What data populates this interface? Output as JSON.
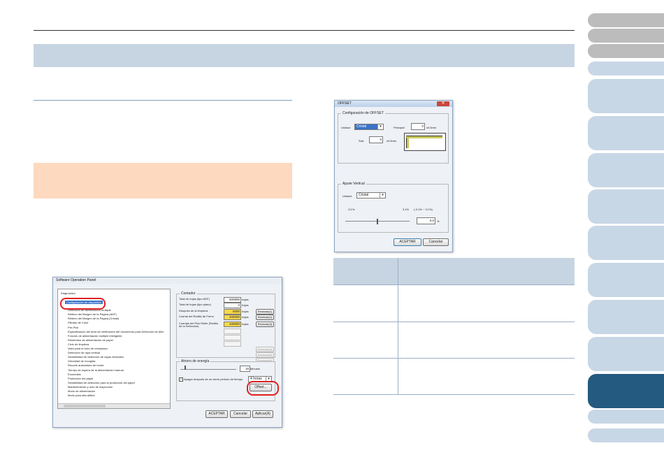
{
  "colors": {
    "header_bar": "#c7d5e2",
    "note_box": "#fcd9bf",
    "nav_active": "#245a80",
    "highlight": "#e02020",
    "counter_yellow": "#f5d84a"
  },
  "nav_tabs": [
    {
      "state": "gray"
    },
    {
      "state": "gray"
    },
    {
      "state": "gray"
    },
    {
      "state": "light"
    },
    {
      "state": "light"
    },
    {
      "state": "light"
    },
    {
      "state": "light"
    },
    {
      "state": "light"
    },
    {
      "state": "light"
    },
    {
      "state": "light"
    },
    {
      "state": "light"
    },
    {
      "state": "light"
    },
    {
      "state": "active"
    },
    {
      "state": "light"
    },
    {
      "state": "light"
    }
  ],
  "sop": {
    "title": "Software Operation Panel",
    "tree_root": "Diagnóstico",
    "tree_selected": "Configuración de dispositivo",
    "tree_items": [
      "Configuración del dispositivo",
      "Detección de alimentación múltiple",
      "Relleno del Margen de la Página (ADF)",
      "Relleno del Margen de la Página (Cristal)",
      "Filtrado de Color",
      "Pre-Pick",
      "Especificación del área de verificación del documento para Detección de Alim",
      "Función de alimentación múltiple inteligente",
      "Reintentos de alimentación de papel",
      "Ciclo de limpieza",
      "Valor para el ciclo de reemplazo",
      "Detección de raya vertical",
      "Sensibilidad de detección de rayas verticales",
      "Velocidad de recogida",
      "Recorte automático de borde",
      "Tiempo de espera de la alimentación manual",
      "Encendido",
      "Protección del papel",
      "Sensibilidad de detección para la protección del papel",
      "Mantenimiento y ciclo de inspección",
      "Modo de alimentación",
      "Modo para alta altitud"
    ],
    "counters_label": "Contador",
    "counters": [
      {
        "label": "Total de hojas (tipo ADF)",
        "value": "500895",
        "unit": "hojas",
        "button": ""
      },
      {
        "label": "Total de hojas (tipo plano)",
        "value": "0",
        "unit": "hojas",
        "button": ""
      },
      {
        "label": "Después de la limpieza",
        "value": "5000",
        "unit": "hojas",
        "button": "Reiniciar(1)"
      },
      {
        "label": "Cuenta del Rodillo de Freno",
        "value": "200000",
        "unit": "hojas",
        "button": "Reiniciar(2)"
      },
      {
        "label": "Cuentas del Pick Roller (Rodillo de la Selección)",
        "value": "100000",
        "unit": "hojas",
        "button": "Reiniciar(3)"
      }
    ],
    "disabled_buttons": [
      "Reiniciar(4)",
      "Reiniciar(5)",
      "Reiniciar(6)"
    ],
    "energy_label": "Ahorro de energía",
    "energy_value": "15",
    "energy_unit": "Minutos",
    "power_off_label": "Apagar después de un cierto periodo de tiempo",
    "power_off_value": "4 horas",
    "offset_button": "Offset...",
    "ok": "ACEPTAR",
    "cancel": "Cancelar",
    "apply": "Aplicar(A)"
  },
  "offset": {
    "title": "OFFSET",
    "close": "✕",
    "config_label": "Configuración de OFFSET",
    "unit_label": "Unidad:",
    "unit_value": "Cristal",
    "principal_label": "Principal:",
    "principal_value": "0",
    "principal_unit": "x0.5mm",
    "sub_label": "Sub:",
    "sub_value": "0",
    "sub_unit": "x0.5mm",
    "vertical_label": "Ajuste Vertical",
    "v_unit_label": "Unidad:",
    "v_unit_value": "Cristal",
    "range_min": "-3.1%",
    "range_max": "3.1%",
    "range_note": "(-3.1% ~ 3.1%)",
    "pct_value": "0.0",
    "pct_unit": "%",
    "slider_level": 0.5,
    "ok": "ACEPTAR",
    "cancel": "Cancelar"
  }
}
